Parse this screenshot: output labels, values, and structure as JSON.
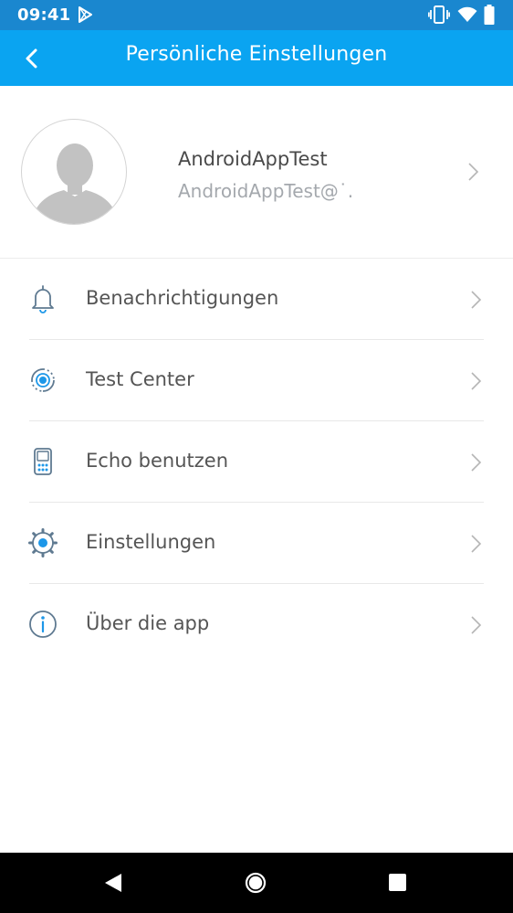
{
  "status_bar": {
    "time": "09:41",
    "icons": [
      "play-store-icon",
      "vibrate-icon",
      "wifi-icon",
      "battery-icon"
    ],
    "background": "#1a87cf"
  },
  "app_bar": {
    "title": "Persönliche Einstellungen",
    "back_icon": "chevron-left-icon",
    "background": "#0aa4f1"
  },
  "profile": {
    "name": "AndroidAppTest",
    "email": "AndroidAppTest@˙.",
    "avatar_icon": "person-silhouette-icon"
  },
  "menu": {
    "items": [
      {
        "label": "Benachrichtigungen",
        "icon": "bell-icon"
      },
      {
        "label": "Test Center",
        "icon": "target-icon"
      },
      {
        "label": "Echo benutzen",
        "icon": "device-keypad-icon"
      },
      {
        "label": "Einstellungen",
        "icon": "gear-icon"
      },
      {
        "label": "Über die app",
        "icon": "info-icon"
      }
    ]
  },
  "colors": {
    "accent": "#0aa4f1",
    "icon_blue": "#1d97e8",
    "text_primary": "#555555",
    "text_secondary": "#a4a8ad",
    "divider": "#e8e8e8"
  },
  "nav_bar": {
    "buttons": [
      "back-triangle-icon",
      "home-circle-icon",
      "recents-square-icon"
    ]
  }
}
